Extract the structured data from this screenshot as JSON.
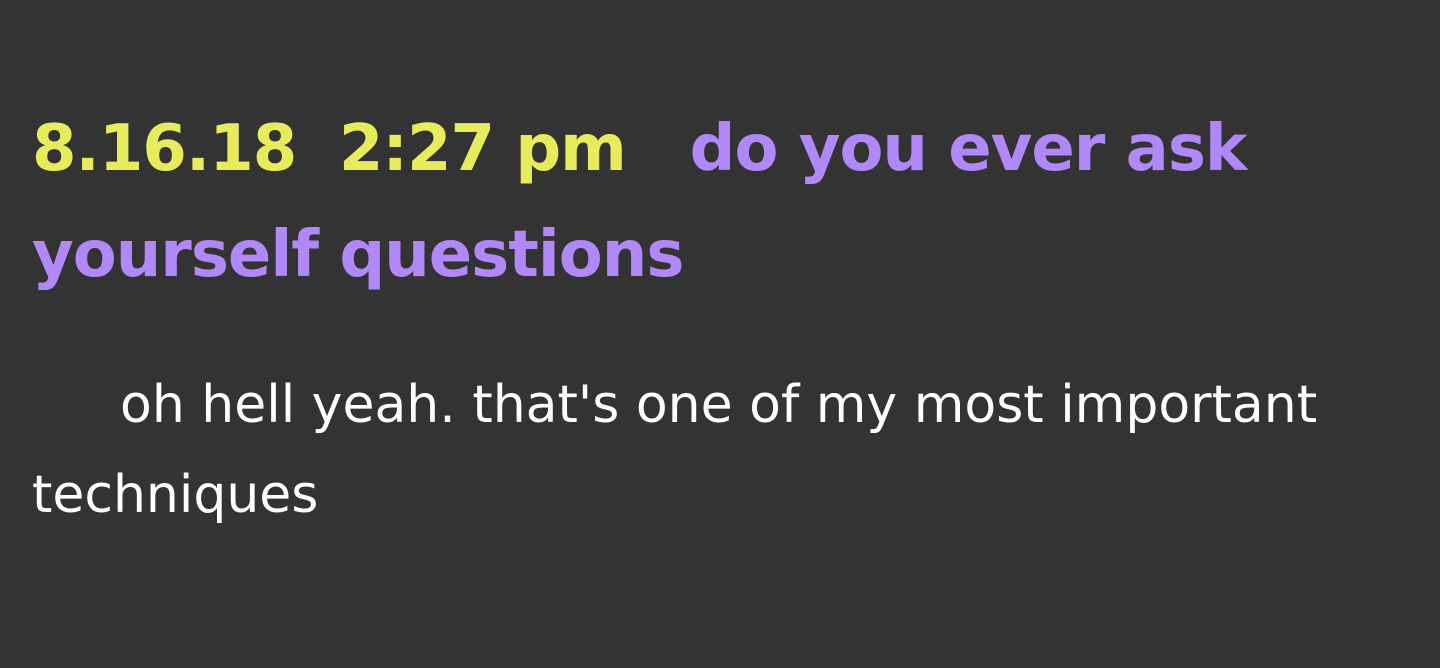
{
  "entry": {
    "date": "8.16.18",
    "time": "2:27 pm",
    "question": "do you ever ask yourself questions",
    "answer": "oh hell yeah. that's one of my most important techniques"
  },
  "colors": {
    "background": "#333333",
    "timestamp": "#e6ec5c",
    "question": "#b088f7",
    "answer": "#ffffff"
  }
}
